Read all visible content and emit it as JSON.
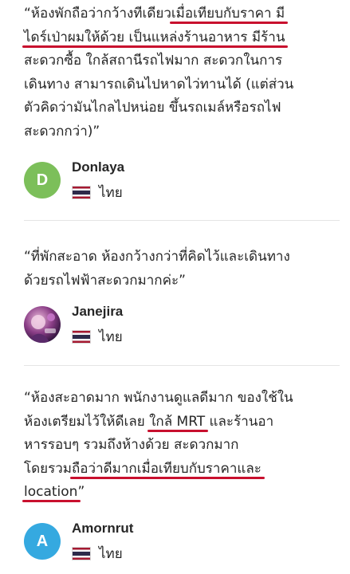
{
  "colors": {
    "underline": "#c8102e",
    "avatar_green": "#7cbf5a",
    "avatar_blue": "#35a9e0"
  },
  "reviews": [
    {
      "lines": [
        [
          "“ห้องพักถือว่ากว้างทีเดียว",
          "เมื่อ",
          "เทียบกับราคา มี"
        ],
        [
          "ไดร์เป่าผมให้ด้วย เป็นแหล่งร้านอาหาร มีร้าน"
        ],
        [
          "สะดวกซื้อ ใกล้สถานีรถไฟมาก สะดวกในการ"
        ],
        [
          "เดินทาง สามารถเดินไปหาดไว่ทานได้ (แต่ส่วน"
        ],
        [
          "ตัวคิดว่ามันไกลไปหน่อย ขึ้นรถเมล์หรือรถไฟ"
        ],
        [
          "สะดวกกว่า)”"
        ]
      ],
      "name": "Donlaya",
      "avatar_initial": "D",
      "country": "ไทย"
    },
    {
      "lines": [
        [
          "“ที่พักสะอาด ห้องกว้างกว่าที่คิดไว้และเดินทาง"
        ],
        [
          "ด้วยรถไฟฟ้าสะดวกมากค่ะ”"
        ]
      ],
      "name": "Janejira",
      "country": "ไทย"
    },
    {
      "lines": [
        [
          "“ห้องสะอาดมาก พนักงานดูแลดีมาก ของใช้ใน"
        ],
        [
          "ห้องเตรียมไว้ให้ดีเลย ",
          "ใกล้ MRT",
          " และร้านอา"
        ],
        [
          "หารรอบๆ รวมถึงห้างด้วย สะดวกมาก"
        ],
        [
          "โดยรวม",
          "ถือว่าดีมากเมื่อเทียบกับราคาและ"
        ],
        [
          "location",
          "”"
        ]
      ],
      "name": "Amornrut",
      "avatar_initial": "A",
      "country": "ไทย"
    }
  ]
}
